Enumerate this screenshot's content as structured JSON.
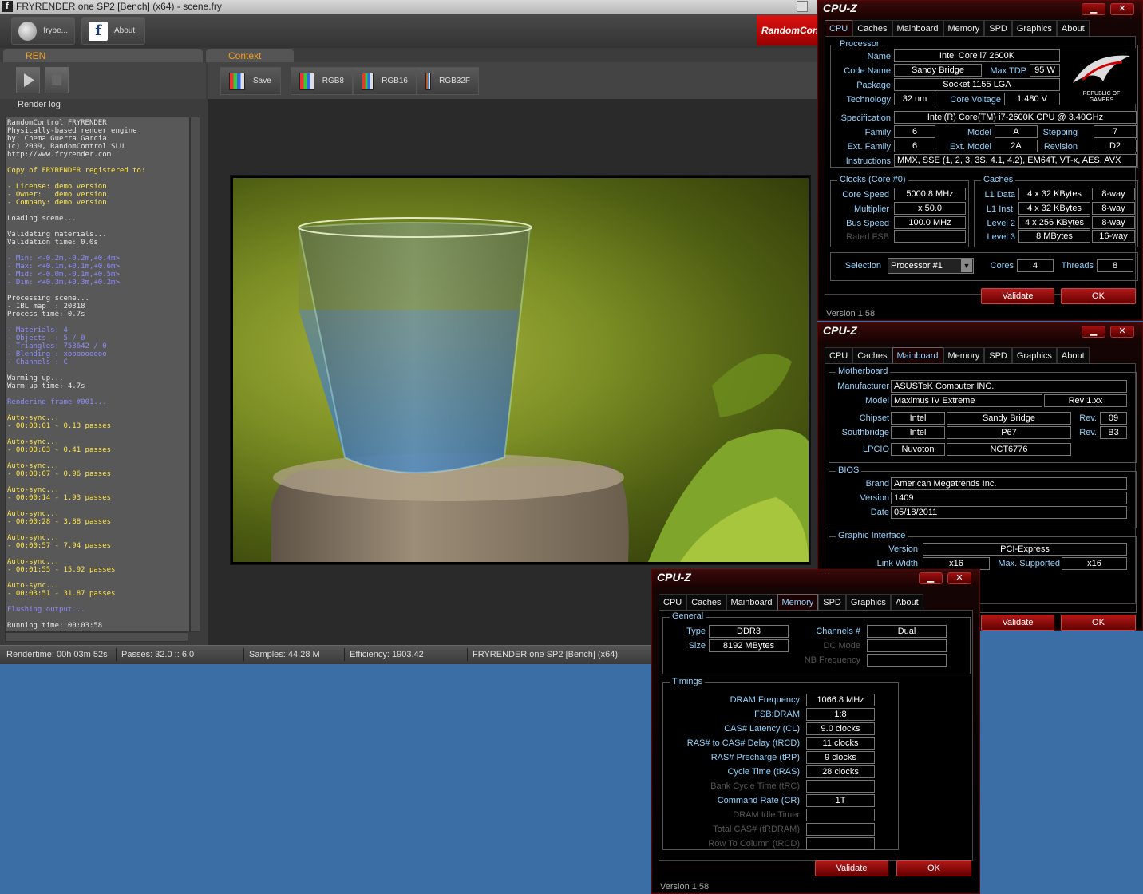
{
  "fry": {
    "title": "FRYRENDER one SP2 [Bench] (x64) - scene.fry",
    "toolbar": {
      "user_label": "frybe...",
      "about_label": "About",
      "banner": "RandomControl"
    },
    "ren_tab": "REN",
    "context_tab": "Context",
    "render_log_label": "Render log",
    "context_buttons": [
      {
        "label": "Save"
      },
      {
        "label": "RGB8"
      },
      {
        "label": "RGB16"
      },
      {
        "label": "RGB32F"
      }
    ],
    "log": [
      {
        "t": "RandomControl FRYRENDER",
        "c": "w"
      },
      {
        "t": "Physically-based render engine",
        "c": "w"
      },
      {
        "t": "by: Chema Guerra Garcia",
        "c": "w"
      },
      {
        "t": "(c) 2009, RandomControl SLU",
        "c": "w"
      },
      {
        "t": "http://www.fryrender.com",
        "c": "w"
      },
      {
        "t": "",
        "c": "w"
      },
      {
        "t": "Copy of FRYRENDER registered to:",
        "c": "y"
      },
      {
        "t": "",
        "c": "w"
      },
      {
        "t": "- License: demo version",
        "c": "y"
      },
      {
        "t": "- Owner:   demo version",
        "c": "y"
      },
      {
        "t": "- Company: demo version",
        "c": "y"
      },
      {
        "t": "",
        "c": "w"
      },
      {
        "t": "Loading scene...",
        "c": "w"
      },
      {
        "t": "",
        "c": "w"
      },
      {
        "t": "Validating materials...",
        "c": "w"
      },
      {
        "t": "Validation time: 0.0s",
        "c": "w"
      },
      {
        "t": "",
        "c": "w"
      },
      {
        "t": "- Min: <-0.2m,-0.2m,+0.4m>",
        "c": "b"
      },
      {
        "t": "- Max: <+0.1m,+0.1m,+0.6m>",
        "c": "b"
      },
      {
        "t": "- Mid: <-0.0m,-0.1m,+0.5m>",
        "c": "b"
      },
      {
        "t": "- Dim: <+0.3m,+0.3m,+0.2m>",
        "c": "b"
      },
      {
        "t": "",
        "c": "w"
      },
      {
        "t": "Processing scene...",
        "c": "w"
      },
      {
        "t": "- IBL map  : 20318",
        "c": "w"
      },
      {
        "t": "Process time: 0.7s",
        "c": "w"
      },
      {
        "t": "",
        "c": "w"
      },
      {
        "t": "- Materials: 4",
        "c": "b"
      },
      {
        "t": "- Objects  : 5 / 0",
        "c": "b"
      },
      {
        "t": "- Triangles: 753642 / 0",
        "c": "b"
      },
      {
        "t": "- Blending : xooooooooo",
        "c": "b"
      },
      {
        "t": "- Channels : C",
        "c": "b"
      },
      {
        "t": "",
        "c": "w"
      },
      {
        "t": "Warming up...",
        "c": "w"
      },
      {
        "t": "Warm up time: 4.7s",
        "c": "w"
      },
      {
        "t": "",
        "c": "w"
      },
      {
        "t": "Rendering frame #001...",
        "c": "b"
      },
      {
        "t": "",
        "c": "w"
      },
      {
        "t": "Auto-sync...",
        "c": "y"
      },
      {
        "t": "- 00:00:01 - 0.13 passes",
        "c": "y"
      },
      {
        "t": "",
        "c": "w"
      },
      {
        "t": "Auto-sync...",
        "c": "y"
      },
      {
        "t": "- 00:00:03 - 0.41 passes",
        "c": "y"
      },
      {
        "t": "",
        "c": "w"
      },
      {
        "t": "Auto-sync...",
        "c": "y"
      },
      {
        "t": "- 00:00:07 - 0.96 passes",
        "c": "y"
      },
      {
        "t": "",
        "c": "w"
      },
      {
        "t": "Auto-sync...",
        "c": "y"
      },
      {
        "t": "- 00:00:14 - 1.93 passes",
        "c": "y"
      },
      {
        "t": "",
        "c": "w"
      },
      {
        "t": "Auto-sync...",
        "c": "y"
      },
      {
        "t": "- 00:00:28 - 3.88 passes",
        "c": "y"
      },
      {
        "t": "",
        "c": "w"
      },
      {
        "t": "Auto-sync...",
        "c": "y"
      },
      {
        "t": "- 00:00:57 - 7.94 passes",
        "c": "y"
      },
      {
        "t": "",
        "c": "w"
      },
      {
        "t": "Auto-sync...",
        "c": "y"
      },
      {
        "t": "- 00:01:55 - 15.92 passes",
        "c": "y"
      },
      {
        "t": "",
        "c": "w"
      },
      {
        "t": "Auto-sync...",
        "c": "y"
      },
      {
        "t": "- 00:03:51 - 31.87 passes",
        "c": "y"
      },
      {
        "t": "",
        "c": "w"
      },
      {
        "t": "Flushing output...",
        "c": "b"
      },
      {
        "t": "",
        "c": "w"
      },
      {
        "t": "Running time: 00:03:58",
        "c": "w"
      }
    ],
    "status": {
      "rendertime": "Rendertime:  00h 03m 52s",
      "passes": "Passes:  32.0 :: 6.0",
      "samples": "Samples:  44.28 M",
      "efficiency": "Efficiency:  1903.42",
      "product": "FRYRENDER one SP2 [Bench] (x64)"
    }
  },
  "cpuz_common": {
    "title": "CPU-Z",
    "tabs": [
      "CPU",
      "Caches",
      "Mainboard",
      "Memory",
      "SPD",
      "Graphics",
      "About"
    ],
    "version": "Version 1.58",
    "validate": "Validate",
    "ok": "OK",
    "min_glyph": "▁",
    "close_glyph": "✕"
  },
  "cpu": {
    "processor_group": "Processor",
    "logo_text": "REPUBLIC OF GAMERS",
    "name_label": "Name",
    "name": "Intel Core i7 2600K",
    "codename_label": "Code Name",
    "codename": "Sandy Bridge",
    "maxtdp_label": "Max TDP",
    "maxtdp": "95 W",
    "package_label": "Package",
    "package": "Socket 1155 LGA",
    "technology_label": "Technology",
    "technology": "32 nm",
    "corevoltage_label": "Core Voltage",
    "corevoltage": "1.480 V",
    "spec_label": "Specification",
    "spec": "Intel(R) Core(TM) i7-2600K CPU @ 3.40GHz",
    "family_label": "Family",
    "family": "6",
    "model_label": "Model",
    "model": "A",
    "stepping_label": "Stepping",
    "stepping": "7",
    "extfamily_label": "Ext. Family",
    "extfamily": "6",
    "extmodel_label": "Ext. Model",
    "extmodel": "2A",
    "revision_label": "Revision",
    "revision": "D2",
    "instructions_label": "Instructions",
    "instructions": "MMX, SSE (1, 2, 3, 3S, 4.1, 4.2), EM64T, VT-x, AES, AVX",
    "clocks_group": "Clocks (Core #0)",
    "corespeed_label": "Core Speed",
    "corespeed": "5000.8 MHz",
    "multiplier_label": "Multiplier",
    "multiplier": "x 50.0",
    "busspeed_label": "Bus Speed",
    "busspeed": "100.0 MHz",
    "ratedfsb_label": "Rated FSB",
    "ratedfsb": "",
    "caches_group": "Caches",
    "l1d_label": "L1 Data",
    "l1d": "4 x 32 KBytes",
    "l1d_way": "8-way",
    "l1i_label": "L1 Inst.",
    "l1i": "4 x 32 KBytes",
    "l1i_way": "8-way",
    "l2_label": "Level 2",
    "l2": "4 x 256 KBytes",
    "l2_way": "8-way",
    "l3_label": "Level 3",
    "l3": "8 MBytes",
    "l3_way": "16-way",
    "selection_label": "Selection",
    "selection": "Processor #1",
    "cores_label": "Cores",
    "cores": "4",
    "threads_label": "Threads",
    "threads": "8"
  },
  "mb": {
    "mb_group": "Motherboard",
    "manufacturer_label": "Manufacturer",
    "manufacturer": "ASUSTeK Computer INC.",
    "model_label": "Model",
    "model": "Maximus IV Extreme",
    "rev": "Rev 1.xx",
    "chipset_label": "Chipset",
    "chipset_vendor": "Intel",
    "chipset": "Sandy Bridge",
    "chipset_rev_label": "Rev.",
    "chipset_rev": "09",
    "southbridge_label": "Southbridge",
    "sb_vendor": "Intel",
    "sb": "P67",
    "sb_rev_label": "Rev.",
    "sb_rev": "B3",
    "lpcio_label": "LPCIO",
    "lpcio_vendor": "Nuvoton",
    "lpcio": "NCT6776",
    "bios_group": "BIOS",
    "brand_label": "Brand",
    "brand": "American Megatrends Inc.",
    "version_label": "Version",
    "version": "1409",
    "date_label": "Date",
    "date": "05/18/2011",
    "gi_group": "Graphic Interface",
    "gi_version_label": "Version",
    "gi_version": "PCI-Express",
    "linkwidth_label": "Link Width",
    "linkwidth": "x16",
    "maxsupported_label": "Max. Supported",
    "maxsupported": "x16"
  },
  "mem": {
    "general_group": "General",
    "type_label": "Type",
    "type": "DDR3",
    "size_label": "Size",
    "size": "8192 MBytes",
    "channels_label": "Channels #",
    "channels": "Dual",
    "dcmode_label": "DC Mode",
    "dcmode": "",
    "nbfreq_label": "NB Frequency",
    "nbfreq": "",
    "timings_group": "Timings",
    "timings": [
      {
        "label": "DRAM Frequency",
        "value": "1066.8 MHz",
        "dim": false
      },
      {
        "label": "FSB:DRAM",
        "value": "1:8",
        "dim": false
      },
      {
        "label": "CAS# Latency (CL)",
        "value": "9.0 clocks",
        "dim": false
      },
      {
        "label": "RAS# to CAS# Delay (tRCD)",
        "value": "11 clocks",
        "dim": false
      },
      {
        "label": "RAS# Precharge (tRP)",
        "value": "9 clocks",
        "dim": false
      },
      {
        "label": "Cycle Time (tRAS)",
        "value": "28 clocks",
        "dim": false
      },
      {
        "label": "Bank Cycle Time (tRC)",
        "value": "",
        "dim": true
      },
      {
        "label": "Command Rate (CR)",
        "value": "1T",
        "dim": false
      },
      {
        "label": "DRAM Idle Timer",
        "value": "",
        "dim": true
      },
      {
        "label": "Total CAS# (tRDRAM)",
        "value": "",
        "dim": true
      },
      {
        "label": "Row To Column (tRCD)",
        "value": "",
        "dim": true
      }
    ]
  }
}
